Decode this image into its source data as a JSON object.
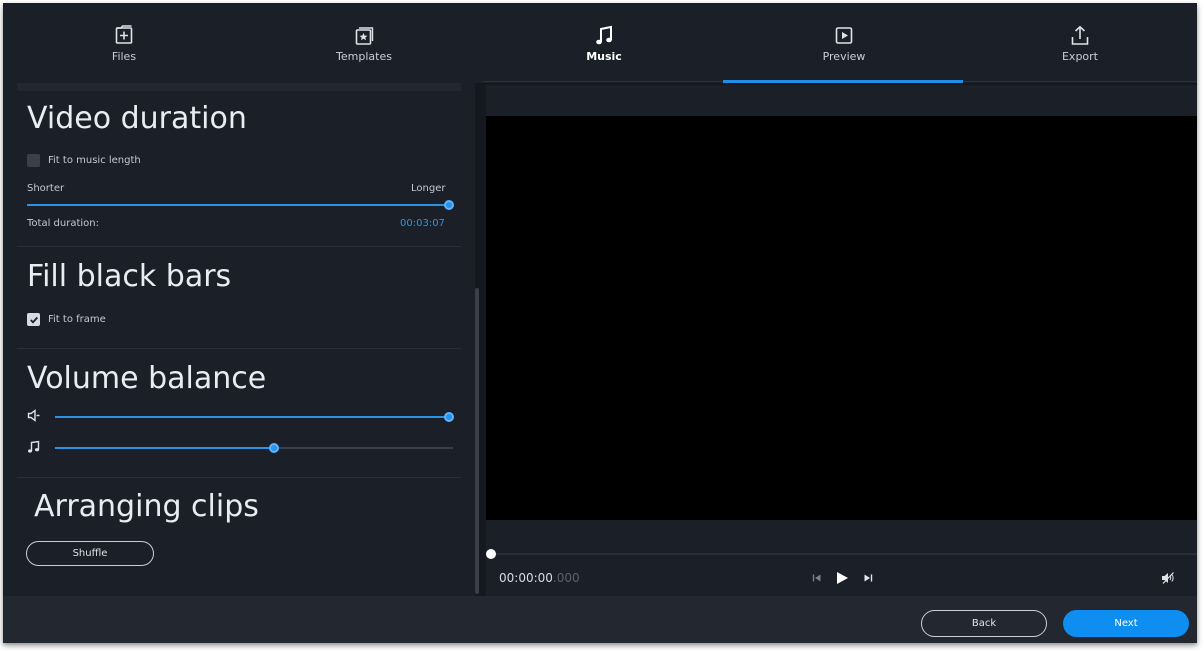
{
  "nav": {
    "tabs": [
      {
        "label": "Files",
        "icon": "add-file-icon"
      },
      {
        "label": "Templates",
        "icon": "templates-icon"
      },
      {
        "label": "Music",
        "icon": "music-note-icon"
      },
      {
        "label": "Preview",
        "icon": "play-square-icon"
      },
      {
        "label": "Export",
        "icon": "export-icon"
      }
    ],
    "active_tab": "Music",
    "underlined_tab": "Preview"
  },
  "video_duration": {
    "title": "Video duration",
    "fit_to_music_label": "Fit to music length",
    "fit_to_music_checked": false,
    "shorter_label": "Shorter",
    "longer_label": "Longer",
    "duration_slider_value": 1.0,
    "total_label": "Total duration:",
    "total_value": "00:03:07"
  },
  "fill_black_bars": {
    "title": "Fill black bars",
    "fit_to_frame_label": "Fit to frame",
    "fit_to_frame_checked": true
  },
  "volume_balance": {
    "title": "Volume balance",
    "video_volume": 1.0,
    "music_volume": 0.55
  },
  "arranging_clips": {
    "title": "Arranging clips",
    "shuffle_label": "Shuffle"
  },
  "player": {
    "time_main": "00:00:00",
    "time_ms": ".000",
    "seek_position": 0
  },
  "footer": {
    "back_label": "Back",
    "next_label": "Next"
  },
  "colors": {
    "accent": "#1e8ee8",
    "background": "#15191f",
    "panel": "#1b1f27",
    "next_button": "#0e8ef0"
  }
}
